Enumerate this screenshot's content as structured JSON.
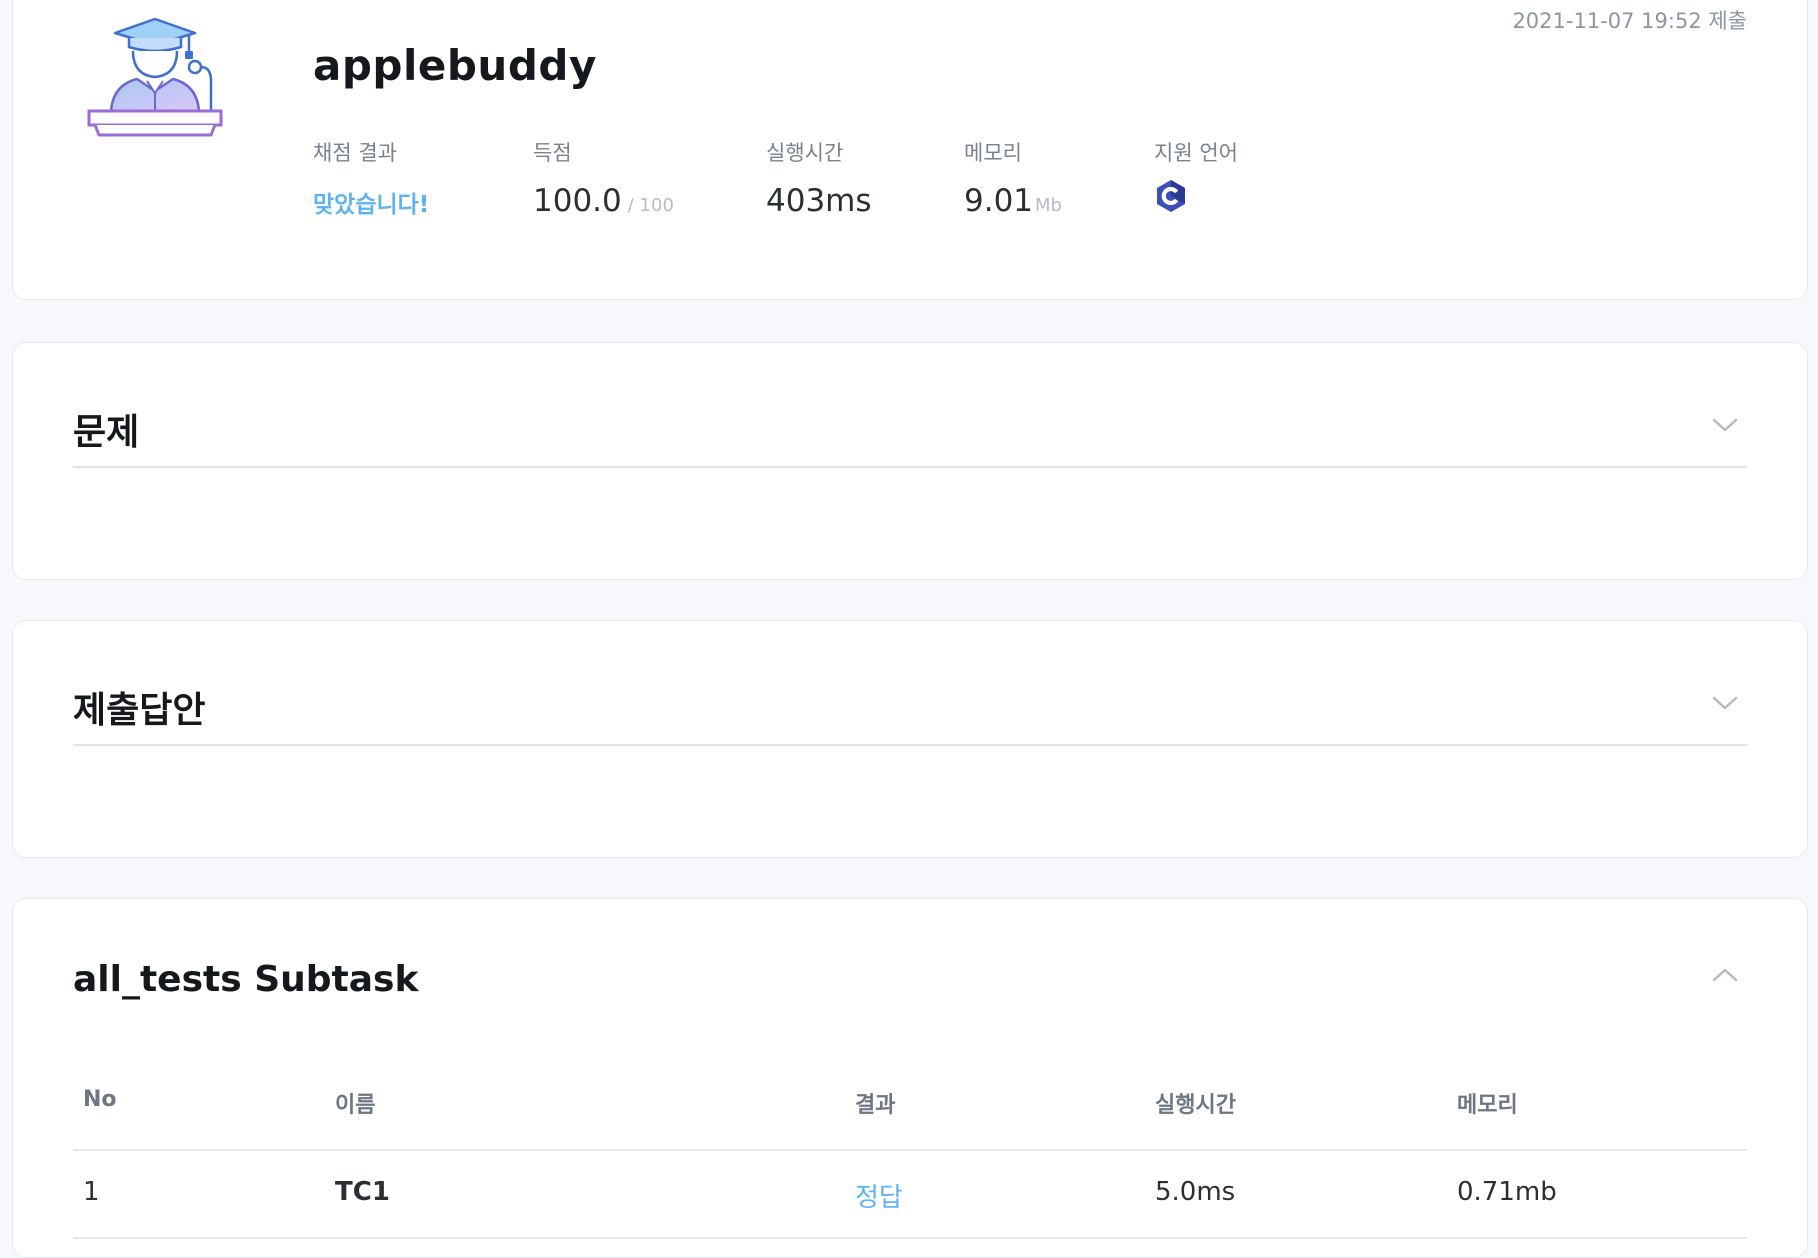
{
  "submission": {
    "submitted_at": "2021-11-07 19:52 제출",
    "username": "applebuddy",
    "avatar_icon": "graduate-lecturer-icon",
    "stats": {
      "result": {
        "label": "채점 결과",
        "value": "맞았습니다!"
      },
      "score": {
        "label": "득점",
        "value": "100.0",
        "max": "/ 100"
      },
      "time": {
        "label": "실행시간",
        "value": "403ms"
      },
      "memory": {
        "label": "메모리",
        "value": "9.01",
        "unit": "Mb"
      },
      "language": {
        "label": "지원 언어",
        "icon": "c-language-icon"
      }
    }
  },
  "sections": {
    "problem": {
      "title": "문제",
      "state": "collapsed"
    },
    "answer": {
      "title": "제출답안",
      "state": "collapsed"
    },
    "subtask": {
      "title": "all_tests Subtask",
      "state": "expanded",
      "columns": [
        "No",
        "이름",
        "결과",
        "실행시간",
        "메모리"
      ],
      "rows": [
        {
          "no": "1",
          "name": "TC1",
          "result": "정답",
          "time": "5.0ms",
          "memory": "0.71mb"
        }
      ]
    }
  },
  "colors": {
    "accent": "#5fb3f1",
    "page_background": "#f7f8fb",
    "card_border": "#e6e9ef",
    "avatar_blue": "#3f6fd0",
    "avatar_purple": "#9b6bd6"
  }
}
